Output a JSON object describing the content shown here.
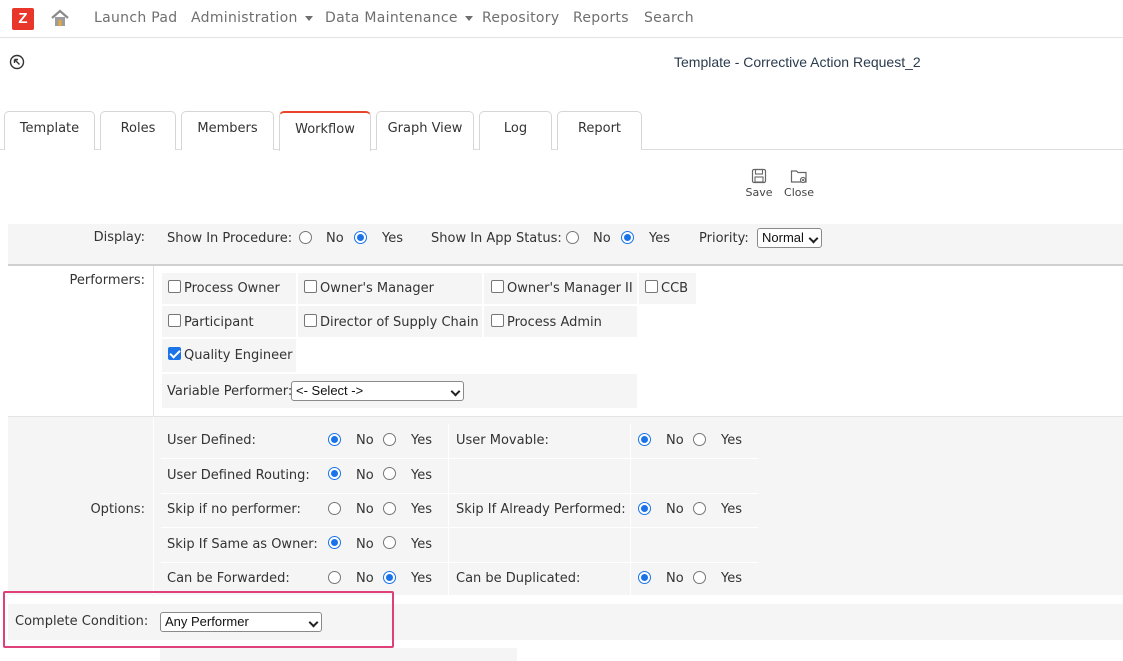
{
  "nav": {
    "logo": "Z",
    "items": [
      {
        "label": "Launch Pad"
      },
      {
        "label": "Administration"
      },
      {
        "label": "Data Maintenance"
      },
      {
        "label": "Repository"
      },
      {
        "label": "Reports"
      },
      {
        "label": "Search"
      }
    ]
  },
  "page": {
    "title": "Template - Corrective Action Request_2"
  },
  "tabs": [
    {
      "label": "Template"
    },
    {
      "label": "Roles"
    },
    {
      "label": "Members"
    },
    {
      "label": "Workflow",
      "active": true
    },
    {
      "label": "Graph View"
    },
    {
      "label": "Log"
    },
    {
      "label": "Report"
    }
  ],
  "toolbar": {
    "save_label": "Save",
    "close_label": "Close"
  },
  "display": {
    "label": "Display:",
    "show_in_procedure": "Show In Procedure:",
    "show_in_app_status": "Show In App Status:",
    "priority_label": "Priority:",
    "priority_value": "Normal",
    "no": "No",
    "yes": "Yes"
  },
  "performers": {
    "label": "Performers:",
    "options": [
      {
        "label": "Process Owner",
        "checked": false
      },
      {
        "label": "Owner's Manager",
        "checked": false
      },
      {
        "label": "Owner's Manager II",
        "checked": false
      },
      {
        "label": "CCB",
        "checked": false
      },
      {
        "label": "Participant",
        "checked": false
      },
      {
        "label": "Director of Supply Chain",
        "checked": false
      },
      {
        "label": "Process Admin",
        "checked": false
      },
      {
        "label": "Quality Engineer",
        "checked": true
      }
    ],
    "variable_label": "Variable Performer:",
    "variable_value": "<- Select ->"
  },
  "options": {
    "label": "Options:",
    "user_defined": "User Defined:",
    "user_movable": "User Movable:",
    "user_defined_routing": "User Defined Routing:",
    "skip_no_performer": "Skip if no performer:",
    "skip_already_performed": "Skip If Already Performed:",
    "skip_same_owner": "Skip If Same as Owner:",
    "can_be_forwarded": "Can be Forwarded:",
    "can_be_duplicated": "Can be Duplicated:",
    "no": "No",
    "yes": "Yes"
  },
  "complete": {
    "label": "Complete Condition:",
    "value": "Any Performer"
  },
  "colors": {
    "accent": "#e8362b",
    "radio": "#1a73e8",
    "highlight": "#e0407a"
  }
}
